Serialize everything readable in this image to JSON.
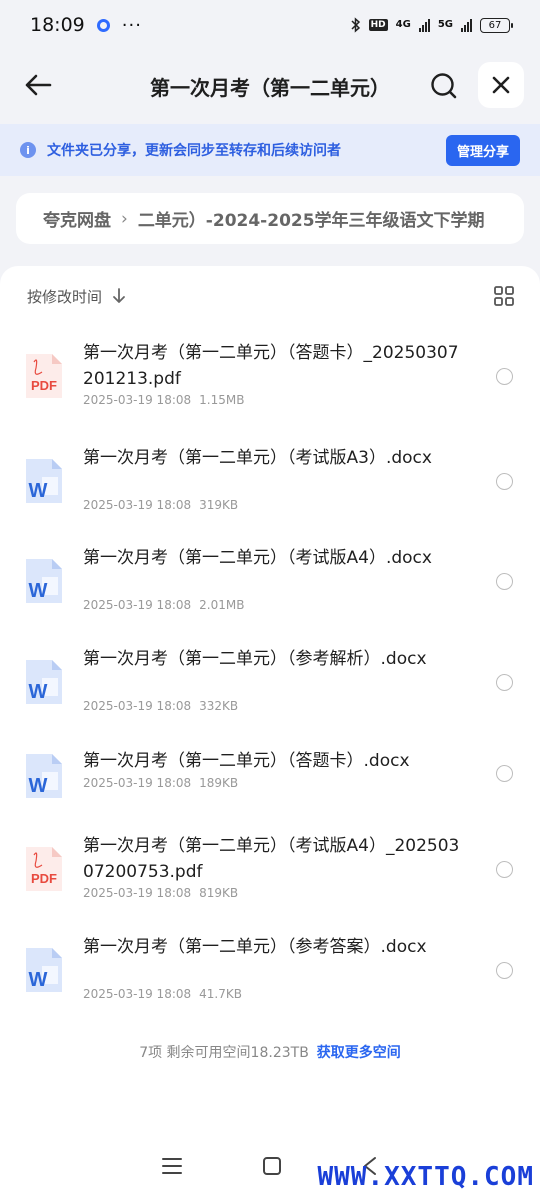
{
  "status_bar": {
    "time": "18:09",
    "more": "···",
    "hd_label": "HD",
    "net1": "4G",
    "net2": "5G",
    "battery": "67"
  },
  "nav": {
    "title": "第一次月考（第一二单元）"
  },
  "share_banner": {
    "text": "文件夹已分享，更新会同步至转存和后续访问者",
    "manage_label": "管理分享"
  },
  "breadcrumb": {
    "root": "夸克网盘",
    "separator": "›",
    "current": "二单元）-2024-2025学年三年级语文下学期"
  },
  "sort": {
    "label": "按修改时间"
  },
  "files": [
    {
      "type": "pdf",
      "icon_label": "PDF",
      "name": "第一次月考（第一二单元）（答题卡）_20250307201213.pdf",
      "date": "2025-03-19 18:08",
      "size": "1.15MB"
    },
    {
      "type": "word",
      "icon_label": "W",
      "name": "第一次月考（第一二单元）（考试版A3）.docx",
      "date": "2025-03-19 18:08",
      "size": "319KB"
    },
    {
      "type": "word",
      "icon_label": "W",
      "name": "第一次月考（第一二单元）（考试版A4）.docx",
      "date": "2025-03-19 18:08",
      "size": "2.01MB"
    },
    {
      "type": "word",
      "icon_label": "W",
      "name": "第一次月考（第一二单元）（参考解析）.docx",
      "date": "2025-03-19 18:08",
      "size": "332KB"
    },
    {
      "type": "word",
      "icon_label": "W",
      "name": "第一次月考（第一二单元）（答题卡）.docx",
      "date": "2025-03-19 18:08",
      "size": "189KB"
    },
    {
      "type": "pdf",
      "icon_label": "PDF",
      "name": "第一次月考（第一二单元）（考试版A4）_20250307200753.pdf",
      "date": "2025-03-19 18:08",
      "size": "819KB"
    },
    {
      "type": "word",
      "icon_label": "W",
      "name": "第一次月考（第一二单元）（参考答案）.docx",
      "date": "2025-03-19 18:08",
      "size": "41.7KB"
    }
  ],
  "footer": {
    "summary": "7项 剩余可用空间18.23TB",
    "more_space": "获取更多空间"
  },
  "watermark": "WWW.XXTTQ.COM",
  "colors": {
    "accent": "#2a66f0",
    "pdf": "#e84a3f",
    "word": "#2b66d8"
  }
}
